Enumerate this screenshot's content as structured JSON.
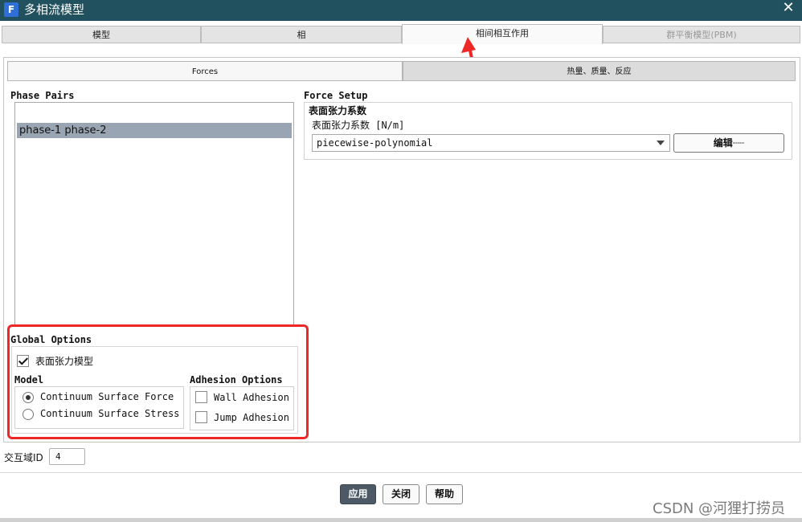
{
  "window": {
    "logo": "F",
    "title": "多相流模型",
    "close_glyph": "✕"
  },
  "top_tabs": [
    {
      "label": "模型"
    },
    {
      "label": "相"
    },
    {
      "label": "相间相互作用"
    },
    {
      "label": "群平衡模型(PBM)"
    }
  ],
  "sub_tabs": [
    {
      "label": "Forces"
    },
    {
      "label": "热量、质量、反应"
    }
  ],
  "phase_pairs": {
    "title": "Phase Pairs",
    "items": [
      "phase-1 phase-2"
    ]
  },
  "force_setup": {
    "title": "Force Setup",
    "group_title": "表面张力系数",
    "field_label": "表面张力系数 [N/m]",
    "method_value": "piecewise-polynomial",
    "edit_label": "编辑┈┈"
  },
  "global_options": {
    "title": "Global Options",
    "surface_tension_label": "表面张力模型",
    "surface_tension_checked": true,
    "model_title": "Model",
    "model_options": [
      "Continuum Surface Force",
      "Continuum Surface Stress"
    ],
    "adhesion_title": "Adhesion Options",
    "adhesion_options": [
      "Wall Adhesion",
      "Jump Adhesion"
    ]
  },
  "interface": {
    "label": "交互域ID",
    "value": "4"
  },
  "buttons": {
    "apply": "应用",
    "close": "关闭",
    "help": "帮助"
  },
  "watermark": "CSDN @河狸打捞员",
  "colors": {
    "titlebar": "#21505f",
    "highlight": "#ee2727",
    "selection": "#9aa5b4",
    "primary_button": "#4d5a66"
  }
}
